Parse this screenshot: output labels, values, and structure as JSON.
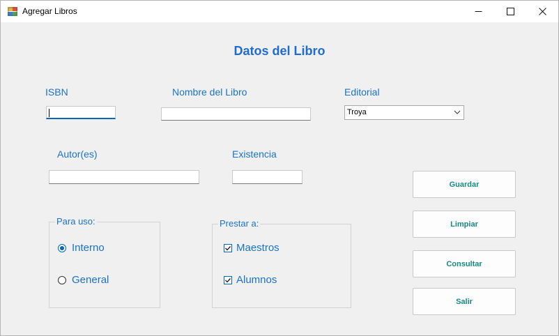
{
  "window": {
    "title": "Agregar Libros"
  },
  "heading": "Datos del Libro",
  "fields": {
    "isbn": {
      "label": "ISBN",
      "value": ""
    },
    "nombre": {
      "label": "Nombre del Libro",
      "value": ""
    },
    "editorial": {
      "label": "Editorial",
      "value": "Troya"
    },
    "autor": {
      "label": "Autor(es)",
      "value": ""
    },
    "existencia": {
      "label": "Existencia",
      "value": ""
    }
  },
  "para_uso": {
    "title": "Para uso:",
    "options": [
      {
        "label": "Interno",
        "checked": true
      },
      {
        "label": "General",
        "checked": false
      }
    ]
  },
  "prestar": {
    "title": "Prestar a:",
    "options": [
      {
        "label": "Maestros",
        "checked": true
      },
      {
        "label": "Alumnos",
        "checked": true
      }
    ]
  },
  "buttons": {
    "guardar": "Guardar",
    "limpiar": "Limpiar",
    "consultar": "Consultar",
    "salir": "Salir"
  },
  "colors": {
    "label": "#1a73c9",
    "heading": "#1f6cd4",
    "button_text": "#178a82",
    "accent": "#0067c0"
  },
  "icons": {
    "app": "app-icon",
    "minimize": "minimize-icon",
    "maximize": "maximize-icon",
    "close": "close-icon",
    "dropdown": "chevron-down-icon"
  }
}
